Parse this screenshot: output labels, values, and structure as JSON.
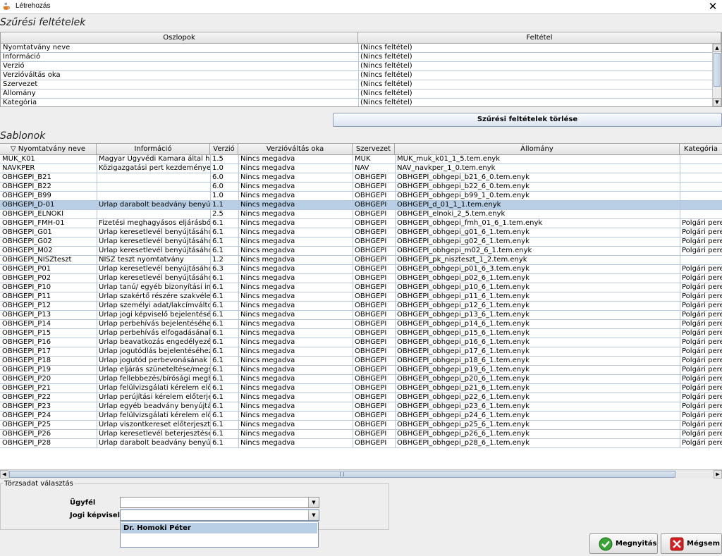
{
  "window": {
    "title": "Létrehozás",
    "close_glyph": "✕"
  },
  "filters": {
    "section_title": "Szűrési feltételek",
    "columns": [
      "Oszlopok",
      "Feltétel"
    ],
    "rows": [
      [
        "Nyomtatvány neve",
        "(Nincs feltétel)"
      ],
      [
        "Információ",
        "(Nincs feltétel)"
      ],
      [
        "Verzió",
        "(Nincs feltétel)"
      ],
      [
        "Verzióváltás oka",
        "(Nincs feltétel)"
      ],
      [
        "Szervezet",
        "(Nincs feltétel)"
      ],
      [
        "Állomány",
        "(Nincs feltétel)"
      ],
      [
        "Kategória",
        "(Nincs feltétel)"
      ]
    ],
    "clear_label": "Szűrési feltételek törlése"
  },
  "templates": {
    "section_title": "Sablonok",
    "sort_glyph": "▽",
    "columns": [
      "Nyomtatvány neve",
      "Információ",
      "Verzió",
      "Verzióváltás oka",
      "Szervezet",
      "Állomány",
      "Kategória"
    ],
    "selected_index": 5,
    "rows": [
      [
        "MUK_K01",
        "Magyar Ügyvédi Kamara által hozo...",
        "1.5",
        "Nincs megadva",
        "MUK",
        "MUK_muk_k01_1_5.tem.enyk",
        ""
      ],
      [
        "NAVKPER",
        "Közigazgatási pert kezdeményező ...",
        "1.0",
        "Nincs megadva",
        "NAV",
        "NAV_navkper_1_0.tem.enyk",
        ""
      ],
      [
        "OBHGEPI_B21",
        "",
        "6.0",
        "Nincs megadva",
        "OBHGEPI",
        "OBHGEPI_obhgepi_b21_6_0.tem.enyk",
        ""
      ],
      [
        "OBHGEPI_B22",
        "",
        "6.0",
        "Nincs megadva",
        "OBHGEPI",
        "OBHGEPI_obhgepi_b22_6_0.tem.enyk",
        ""
      ],
      [
        "OBHGEPI_B99",
        "",
        "1.0",
        "Nincs megadva",
        "OBHGEPI",
        "OBHGEPI_obhgepi_b99_1_0.tem.enyk",
        ""
      ],
      [
        "OBHGEPI_D-01",
        "Űrlap darabolt beadvány benyújtá...",
        "1.1",
        "Nincs megadva",
        "OBHGEPI",
        "OBHGEPI_d_01_1_1.tem.enyk",
        ""
      ],
      [
        "OBHGEPI_ELNOKI",
        "",
        "2.5",
        "Nincs megadva",
        "OBHGEPI",
        "OBHGEPI_elnoki_2_5.tem.enyk",
        ""
      ],
      [
        "OBHGEPI_FMH-01",
        "Fizetési meghagyásos eljárásból ...",
        "6.1",
        "Nincs megadva",
        "OBHGEPI",
        "OBHGEPI_obhgepi_fmh_01_6_1.tem.enyk",
        "Polgári peres"
      ],
      [
        "OBHGEPI_G01",
        "Űrlap keresetlevél benyújtásához ...",
        "6.1",
        "Nincs megadva",
        "OBHGEPI",
        "OBHGEPI_obhgepi_g01_6_1.tem.enyk",
        "Polgári peres"
      ],
      [
        "OBHGEPI_G02",
        "Űrlap keresetlevél benyújtásához ...",
        "6.1",
        "Nincs megadva",
        "OBHGEPI",
        "OBHGEPI_obhgepi_g02_6_1.tem.enyk",
        "Polgári peres"
      ],
      [
        "OBHGEPI_M02",
        "Űrlap keresetlevél benyújtásához ...",
        "6.1",
        "Nincs megadva",
        "OBHGEPI",
        "OBHGEPI_obhgepi_m02_6_1.tem.enyk",
        "Polgári peres"
      ],
      [
        "OBHGEPI_NISZteszt",
        "NISZ teszt nyomtatvány",
        "1.2",
        "Nincs megadva",
        "OBHGEPI",
        "OBHGEPI_pk_niszteszt_1_2.tem.enyk",
        ""
      ],
      [
        "OBHGEPI_P01",
        "Űrlap keresetlevél benyújtásához ...",
        "6.3",
        "Nincs megadva",
        "OBHGEPI",
        "OBHGEPI_obhgepi_p01_6_3.tem.enyk",
        "Polgári peres"
      ],
      [
        "OBHGEPI_P02",
        "Űrlap keresetlevél benyújtásához ...",
        "6.1",
        "Nincs megadva",
        "OBHGEPI",
        "OBHGEPI_obhgepi_p02_6_1.tem.enyk",
        "Polgári peres"
      ],
      [
        "OBHGEPI_P10",
        "Űrlap tanú/ egyéb bizonyítási indítv...",
        "6.1",
        "Nincs megadva",
        "OBHGEPI",
        "OBHGEPI_obhgepi_p10_6_1.tem.enyk",
        "Polgári peres"
      ],
      [
        "OBHGEPI_P11",
        "Űrlap szakértő részére szakvélem...",
        "6.1",
        "Nincs megadva",
        "OBHGEPI",
        "OBHGEPI_obhgepi_p11_6_1.tem.enyk",
        "Polgári peres"
      ],
      [
        "OBHGEPI_P12",
        "Űrlap személyi adat/lakcímváltozá...",
        "6.1",
        "Nincs megadva",
        "OBHGEPI",
        "OBHGEPI_obhgepi_p12_6_1.tem.enyk",
        "Polgári peres"
      ],
      [
        "OBHGEPI_P13",
        "Űrlap jogi képviselő bejelentéséh...",
        "6.1",
        "Nincs megadva",
        "OBHGEPI",
        "OBHGEPI_obhgepi_p13_6_1.tem.enyk",
        "Polgári peres"
      ],
      [
        "OBHGEPI_P14",
        "Űrlap perbehívás bejelentéséhez ...",
        "6.1",
        "Nincs megadva",
        "OBHGEPI",
        "OBHGEPI_obhgepi_p14_6_1.tem.enyk",
        "Polgári peres"
      ],
      [
        "OBHGEPI_P15",
        "Űrlap perbehívás elfogadásának/...",
        "6.1",
        "Nincs megadva",
        "OBHGEPI",
        "OBHGEPI_obhgepi_p15_6_1.tem.enyk",
        "Polgári peres"
      ],
      [
        "OBHGEPI_P16",
        "Űrlap beavatkozás engedélyezése...",
        "6.1",
        "Nincs megadva",
        "OBHGEPI",
        "OBHGEPI_obhgepi_p16_6_1.tem.enyk",
        "Polgári peres"
      ],
      [
        "OBHGEPI_P17",
        "Űrlap jogutódlás bejelentéséhez ...",
        "6.1",
        "Nincs megadva",
        "OBHGEPI",
        "OBHGEPI_obhgepi_p17_6_1.tem.enyk",
        "Polgári peres"
      ],
      [
        "OBHGEPI_P18",
        "Űrlap jogutód perbevonásának be...",
        "6.1",
        "Nincs megadva",
        "OBHGEPI",
        "OBHGEPI_obhgepi_p18_6_1.tem.enyk",
        "Polgári peres"
      ],
      [
        "OBHGEPI_P19",
        "Űrlap eljárás szüneteltése/megszü...",
        "6.1",
        "Nincs megadva",
        "OBHGEPI",
        "OBHGEPI_obhgepi_p19_6_1.tem.enyk",
        "Polgári peres"
      ],
      [
        "OBHGEPI_P20",
        "Űrlap fellebbezés/bírósági megha...",
        "6.1",
        "Nincs megadva",
        "OBHGEPI",
        "OBHGEPI_obhgepi_p20_6_1.tem.enyk",
        "Polgári peres"
      ],
      [
        "OBHGEPI_P21",
        "Űrlap felülvizsgálati kérelem előter...",
        "6.1",
        "Nincs megadva",
        "OBHGEPI",
        "OBHGEPI_obhgepi_p21_6_1.tem.enyk",
        "Polgári peres"
      ],
      [
        "OBHGEPI_P22",
        "Űrlap perújítási kérelem előterjesz...",
        "6.1",
        "Nincs megadva",
        "OBHGEPI",
        "OBHGEPI_obhgepi_p22_6_1.tem.enyk",
        "Polgári peres"
      ],
      [
        "OBHGEPI_P23",
        "Űrlap egyéb beadvány benyújtásá...",
        "6.1",
        "Nincs megadva",
        "OBHGEPI",
        "OBHGEPI_obhgepi_p23_6_1.tem.enyk",
        "Polgári peres"
      ],
      [
        "OBHGEPI_P24",
        "Űrlap felülvizsgálati kérelem előter...",
        "6.1",
        "Nincs megadva",
        "OBHGEPI",
        "OBHGEPI_obhgepi_p24_6_1.tem.enyk",
        "Polgári peres"
      ],
      [
        "OBHGEPI_P25",
        "Űrlap viszontkereset előterjesztés...",
        "6.1",
        "Nincs megadva",
        "OBHGEPI",
        "OBHGEPI_obhgepi_p25_6_1.tem.enyk",
        "Polgári peres"
      ],
      [
        "OBHGEPI_P26",
        "Űrlap keresetlevél beterjesztéséh...",
        "6.1",
        "Nincs megadva",
        "OBHGEPI",
        "OBHGEPI_obhgepi_p26_6_1.tem.enyk",
        "Polgári peres"
      ],
      [
        "OBHGEPI_P28",
        "Űrlap darabolt beadvány benyújtá...",
        "6.1",
        "Nincs megadva",
        "OBHGEPI",
        "OBHGEPI_obhgepi_p28_6_1.tem.enyk",
        "Polgári peres"
      ]
    ]
  },
  "master_data": {
    "legend": "Törzsadat választás",
    "client_label": "Ügyfél",
    "client_value": "",
    "lawyer_label": "Jogi képviselő",
    "lawyer_value": "",
    "dropdown_option": "Dr. Homoki Péter"
  },
  "buttons": {
    "open_label": "Megnyitás",
    "cancel_label": "Mégsem"
  },
  "icons": {
    "app": "java-cup-icon",
    "close": "close-icon",
    "open": "check-icon",
    "cancel": "cancel-x-icon",
    "sort": "sort-descending-icon",
    "dropdown": "chevron-down-icon"
  },
  "colors": {
    "selection": "#b8cfe5",
    "grid": "#b8c8dc",
    "cancel_red": "#d42020",
    "ok_green": "#3aa335"
  }
}
